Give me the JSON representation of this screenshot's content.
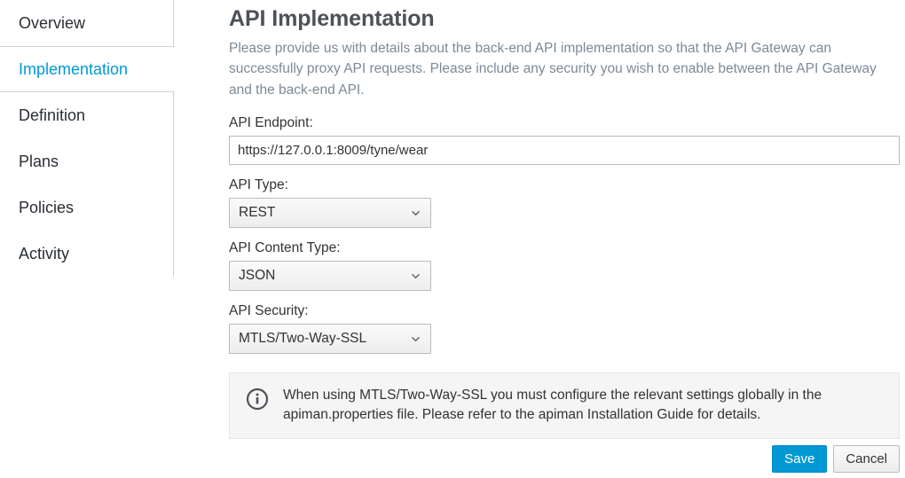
{
  "sidebar": {
    "items": [
      {
        "label": "Overview",
        "active": false
      },
      {
        "label": "Implementation",
        "active": true
      },
      {
        "label": "Definition",
        "active": false
      },
      {
        "label": "Plans",
        "active": false
      },
      {
        "label": "Policies",
        "active": false
      },
      {
        "label": "Activity",
        "active": false
      }
    ]
  },
  "main": {
    "title": "API Implementation",
    "description": "Please provide us with details about the back-end API implementation so that the API Gateway can successfully proxy API requests. Please include any security you wish to enable between the API Gateway and the back-end API.",
    "fields": {
      "endpoint": {
        "label": "API Endpoint:",
        "value": "https://127.0.0.1:8009/tyne/wear",
        "placeholder": ""
      },
      "api_type": {
        "label": "API Type:",
        "value": "REST"
      },
      "content_type": {
        "label": "API Content Type:",
        "value": "JSON"
      },
      "security": {
        "label": "API Security:",
        "value": "MTLS/Two-Way-SSL"
      }
    },
    "alert": {
      "icon": "info-circle-icon",
      "text": "When using MTLS/Two-Way-SSL you must configure the relevant settings globally in the apiman.properties file. Please refer to the apiman Installation Guide for details."
    }
  },
  "footer": {
    "save_label": "Save",
    "cancel_label": "Cancel"
  },
  "colors": {
    "accent": "#0099d3",
    "primary_button": "#0099d3",
    "description_text": "#7b8a98",
    "border": "#d1d1d1",
    "alert_bg": "#f5f5f5"
  }
}
